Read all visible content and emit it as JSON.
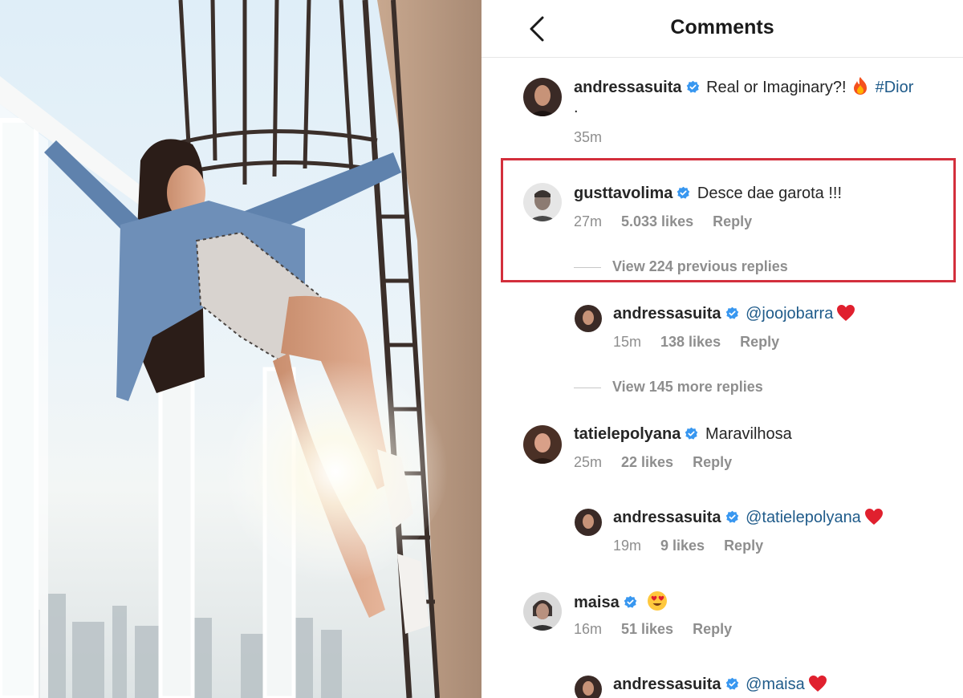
{
  "header": {
    "title": "Comments"
  },
  "colors": {
    "verified": "#3897f0",
    "highlight_box": "#d32f3c",
    "meta": "#8e8e8e",
    "mention": "#1f5b8a"
  },
  "caption": {
    "username": "andressasuita",
    "text": "Real or Imaginary?!",
    "emoji": "fire",
    "hashtag": "#Dior",
    "second_line": ".",
    "time": "35m"
  },
  "comments": [
    {
      "username": "gusttavolima",
      "text": "Desce dae garota !!!",
      "time": "27m",
      "likes": "5.033 likes",
      "reply_label": "Reply",
      "view_replies": "View 224 previous replies",
      "highlighted": true,
      "replies": [
        {
          "username": "andressasuita",
          "mention": "@joojobarra",
          "emoji": "red-heart",
          "time": "15m",
          "likes": "138 likes",
          "reply_label": "Reply"
        }
      ],
      "more_replies": "View 145 more replies"
    },
    {
      "username": "tatielepolyana",
      "text": "Maravilhosa",
      "time": "25m",
      "likes": "22 likes",
      "reply_label": "Reply",
      "replies": [
        {
          "username": "andressasuita",
          "mention": "@tatielepolyana",
          "emoji": "red-heart",
          "time": "19m",
          "likes": "9 likes",
          "reply_label": "Reply"
        }
      ]
    },
    {
      "username": "maisa",
      "text": "",
      "emoji": "heart-eyes",
      "time": "16m",
      "likes": "51 likes",
      "reply_label": "Reply",
      "replies": [
        {
          "username": "andressasuita",
          "mention": "@maisa",
          "emoji": "red-heart"
        }
      ]
    }
  ]
}
